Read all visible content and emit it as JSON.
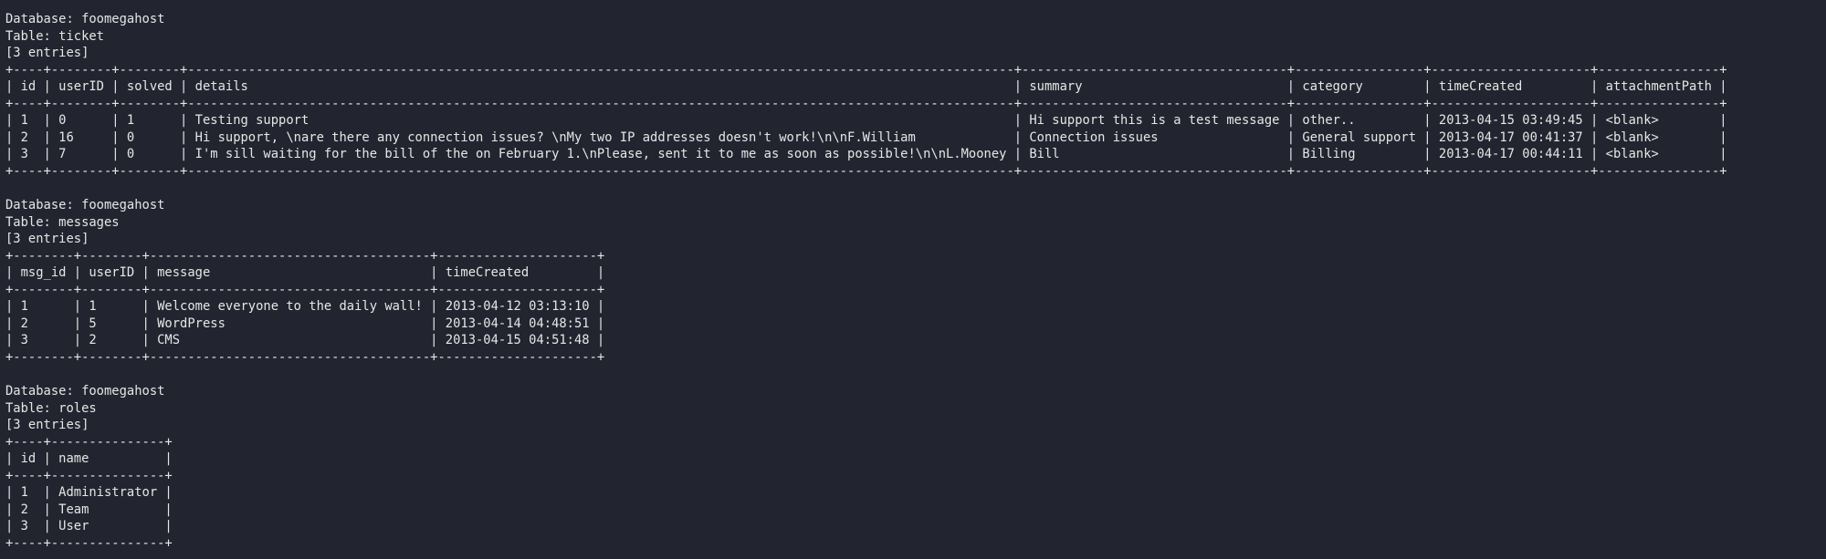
{
  "blocks": [
    {
      "header": [
        "Database: foomegahost",
        "Table: ticket",
        "[3 entries]"
      ],
      "columns": [
        "id",
        "userID",
        "solved",
        "details",
        "summary",
        "category",
        "timeCreated",
        "attachmentPath"
      ],
      "rows": [
        [
          "1",
          "0",
          "1",
          "Testing support",
          "Hi support this is a test message",
          "other..",
          "2013-04-15 03:49:45",
          "<blank>"
        ],
        [
          "2",
          "16",
          "0",
          "Hi support, \\nare there any connection issues? \\nMy two IP addresses doesn't work!\\n\\nF.William",
          "Connection issues",
          "General support",
          "2013-04-17 00:41:37",
          "<blank>"
        ],
        [
          "3",
          "7",
          "0",
          "I'm sill waiting for the bill of the on February 1.\\nPlease, sent it to me as soon as possible!\\n\\nL.Mooney",
          "Bill",
          "Billing",
          "2013-04-17 00:44:11",
          "<blank>"
        ]
      ]
    },
    {
      "header": [
        "Database: foomegahost",
        "Table: messages",
        "[3 entries]"
      ],
      "columns": [
        "msg_id",
        "userID",
        "message",
        "timeCreated"
      ],
      "rows": [
        [
          "1",
          "1",
          "Welcome everyone to the daily wall!",
          "2013-04-12 03:13:10"
        ],
        [
          "2",
          "5",
          "WordPress",
          "2013-04-14 04:48:51"
        ],
        [
          "3",
          "2",
          "CMS",
          "2013-04-15 04:51:48"
        ]
      ]
    },
    {
      "header": [
        "Database: foomegahost",
        "Table: roles",
        "[3 entries]"
      ],
      "columns": [
        "id",
        "name"
      ],
      "rows": [
        [
          "1",
          "Administrator"
        ],
        [
          "2",
          "Team"
        ],
        [
          "3",
          "User"
        ]
      ]
    }
  ]
}
